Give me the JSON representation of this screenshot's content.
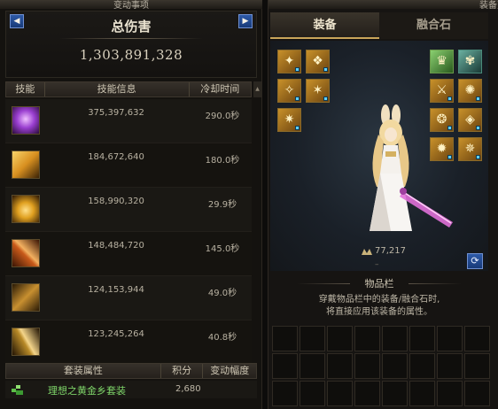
{
  "left": {
    "header_title": "变动事项",
    "summary": {
      "title": "总伤害",
      "total": "1,303,891,328",
      "prev_icon": "triangle-left-icon",
      "next_icon": "triangle-right-icon"
    },
    "columns": [
      "技能",
      "技能信息",
      "冷却时间"
    ],
    "skills": [
      {
        "damage": "375,397,632",
        "cooldown": "290.0秒",
        "icon": "purple-spirit-icon",
        "color": "#9a3fd0"
      },
      {
        "damage": "184,672,640",
        "cooldown": "180.0秒",
        "icon": "golden-wings-icon",
        "color": "#d89020"
      },
      {
        "damage": "158,990,320",
        "cooldown": "29.9秒",
        "icon": "burst-hand-icon",
        "color": "#e0a020"
      },
      {
        "damage": "148,484,720",
        "cooldown": "145.0秒",
        "icon": "cross-slash-icon",
        "color": "#c85a1a"
      },
      {
        "damage": "124,153,944",
        "cooldown": "49.0秒",
        "icon": "sword-strike-icon",
        "color": "#c89030"
      },
      {
        "damage": "123,245,264",
        "cooldown": "40.8秒",
        "icon": "lightning-blade-icon",
        "color": "#b88a28"
      }
    ],
    "set_columns": [
      "套装属性",
      "积分",
      "变动幅度"
    ],
    "set_row": {
      "name": "理想之黄金乡套装",
      "score": "2,680",
      "icon": "set-bonus-icon"
    }
  },
  "right": {
    "header_title": "装备变",
    "tabs": [
      "装备",
      "融合石"
    ],
    "power_value": "77,217",
    "power_icon": "crest-icon",
    "power_dash": "–",
    "refresh_icon": "refresh-icon",
    "inventory_title": "物品栏",
    "inventory_desc_line1": "穿戴物品栏中的装备/融合石时,",
    "inventory_desc_line2": "将直接应用该装备的属性。"
  }
}
